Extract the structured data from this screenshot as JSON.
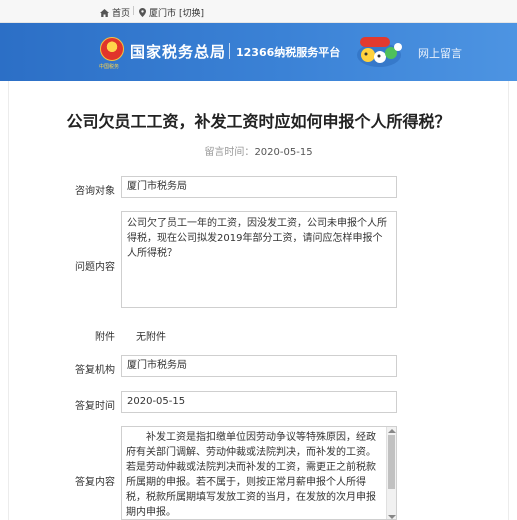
{
  "topbar": {
    "home_label": "首页",
    "location_label": "厦门市",
    "switch_label": "[切换]"
  },
  "banner": {
    "emblem_text": "中国税务",
    "title": "国家税务总局",
    "subtitle": "12366纳税服务平台",
    "message_label": "网上留言"
  },
  "article": {
    "title": "公司欠员工工资，补发工资时应如何申报个人所得税？",
    "date_label": "留言时间：",
    "date_value": "2020-05-15"
  },
  "form": {
    "consult_target_label": "咨询对象",
    "consult_target_value": "厦门市税务局",
    "question_label": "问题内容",
    "question_value": "公司欠了员工一年的工资，因没发工资，公司未申报个人所得税，现在公司拟发2019年部分工资，请问应怎样申报个人所得税？",
    "attachment_label": "附件",
    "attachment_value": "无附件",
    "reply_org_label": "答复机构",
    "reply_org_value": "厦门市税务局",
    "reply_time_label": "答复时间",
    "reply_time_value": "2020-05-15",
    "reply_content_label": "答复内容",
    "reply_content_value": "补发工资是指扣缴单位因劳动争议等特殊原因，经政府有关部门调解、劳动仲裁或法院判决，而补发的工资。若是劳动仲裁或法院判决而补发的工资，需更正之前税款所属期的申报。若不属于，则按正常月薪申报个人所得税，税款所属期填写发放工资的当月，在发放的次月申报期内申报。"
  },
  "colors": {
    "banner_blue": "#3b82d6",
    "border_gray": "#cfcfcf"
  }
}
